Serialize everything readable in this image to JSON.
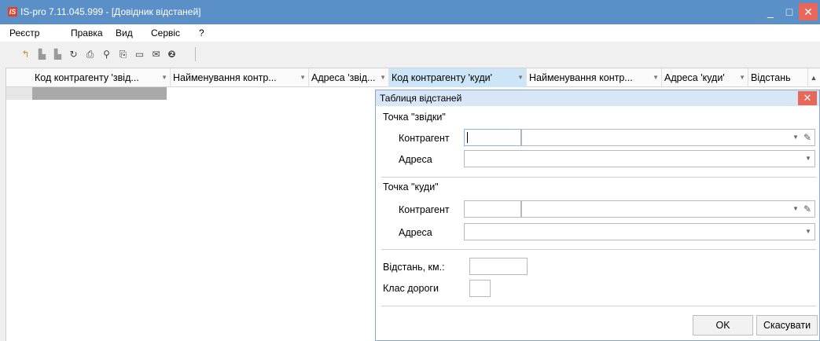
{
  "window": {
    "logo": "IS",
    "title": "IS-pro 7.11.045.999 - [Довідник відстаней]",
    "minimize": "_",
    "maximize": "□",
    "close": "✕"
  },
  "menu": [
    "Реєстр",
    "Правка",
    "Вид",
    "Сервіс",
    "?"
  ],
  "toolbar": {
    "icons": [
      "new-icon",
      "copy-icon",
      "paste-icon",
      "refresh-icon",
      "print-icon",
      "find-icon",
      "filter-icon",
      "document-icon",
      "mail-icon",
      "help-icon"
    ]
  },
  "grid": {
    "columns": [
      "Код контрагенту 'звід...",
      "Найменування контр...",
      "Адреса 'звід...",
      "Код контрагенту 'куди'",
      "Найменування контр...",
      "Адреса 'куди'",
      "Відстань"
    ]
  },
  "dialog": {
    "title": "Таблиця відстаней",
    "close": "✕",
    "from_section": "Точка \"звідки\"",
    "to_section": "Точка \"куди\"",
    "counterparty_label": "Контрагент",
    "address_label": "Адреса",
    "distance_label": "Відстань, км.:",
    "road_class_label": "Клас дороги",
    "ok_label": "OK",
    "cancel_label": "Скасувати",
    "from": {
      "code": "",
      "name": "",
      "address": ""
    },
    "to": {
      "code": "",
      "name": "",
      "address": ""
    },
    "distance": "",
    "road_class": ""
  }
}
